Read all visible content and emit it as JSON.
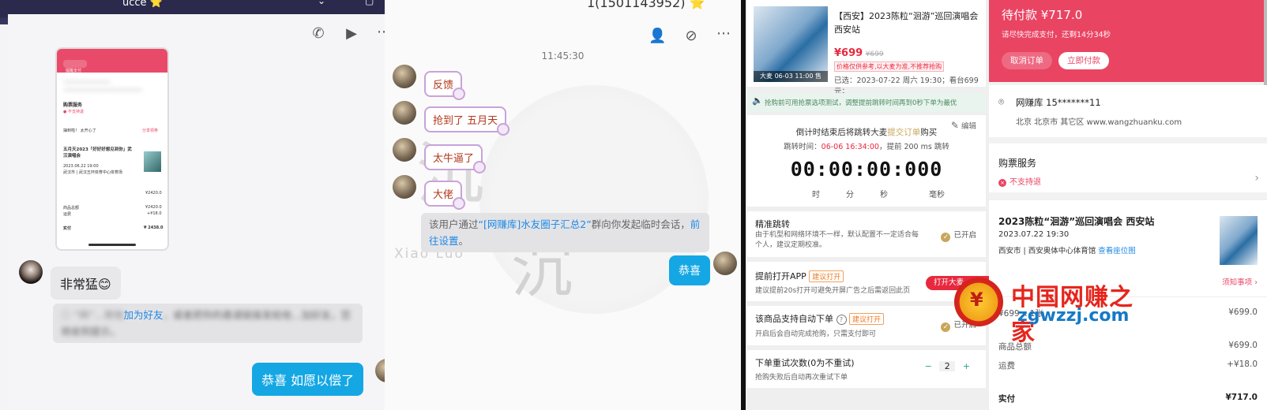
{
  "panel1": {
    "title": "ucce ⭐",
    "mini_phone": {
      "header_btn": "提醒支付",
      "service": "购票服务",
      "not_refund": "● 不支持退",
      "notice": "抽到啦！ 太开心了",
      "notice_tag": "分享领券",
      "event_title": "五月天2023「好好好想见到你」武汉演唱会",
      "event_date": "2023.06.22 19:00",
      "venue": "武汉市 | 武汉五环体育中心体育场",
      "price_row": "¥2420.0",
      "subtotal_label": "商品总额",
      "subtotal": "¥2420.0",
      "fee_label": "运费",
      "fee": "+¥18.0",
      "total_label": "实付",
      "total": "¥ 2438.0"
    },
    "msg_great": "非常猛😊",
    "sys_link1": "加为好友",
    "sys_text": "，或者把你的邀请链接发给他…加好友，您将收到提示。",
    "msg_congrats": "恭喜 如愿以偿了"
  },
  "panel2": {
    "header": "1(1501143952) ⭐",
    "time": "11:45:30",
    "stickers": [
      "反馈",
      "抢到了 五月天",
      "太牛逼了",
      "大佬"
    ],
    "sys_prefix": "该用户通过",
    "sys_group": "“[网赚库]水友圈子汇总2”",
    "sys_middle": "群向你发起临时会话，",
    "sys_link": "前往设置",
    "sys_end": "。",
    "watermark_en": "Xiao Luo",
    "msg_reply": "恭喜"
  },
  "panel3": {
    "event_title": "【西安】2023陈粒“洄游”巡回演唱会 西安站",
    "price": "¥699",
    "price_strike": "¥699",
    "price_note": "价格仅供参考,以大麦为准,不推荐抢购",
    "poster_ribbon": "大麦 06-03 11:00 售",
    "selected": "已选：2023-07-22 周六 19:30；看台699元；",
    "notice": "抢购前可用抢票选项测试，调整提前跳转时间再到0秒下单为最优",
    "countdown_title": "倒计时结束后将跳转大麦",
    "countdown_link": "提交订单",
    "countdown_suffix": "购买",
    "edit": "编辑",
    "jump_time_label": "跳转时间：",
    "jump_time": "06-06 16:34:00",
    "jump_advance": "，提前 200 ms 跳转",
    "timer": "00:00:00:000",
    "units": [
      "时",
      "分",
      "秒",
      "毫秒"
    ],
    "precise_title": "精准跳转",
    "precise_desc": "由于机型和网络环境不一样，默认配置不一定适合每个人，建议定期校准。",
    "precise_status": "已开启",
    "open_app_title": "提前打开APP",
    "open_app_tag": "建议打开",
    "open_app_desc": "建议提前20s打开可避免开屏广告之后需返回此页",
    "open_app_btn": "打开大麦",
    "auto_title": "该商品支持自动下单",
    "auto_tag": "建议打开",
    "auto_desc": "开启后会自动完成抢购，只需支付即可",
    "auto_status": "已开启",
    "retry_title": "下单重试次数(0为不重试)",
    "retry_desc": "抢购失败后自动再次重试下单",
    "retry_value": "2",
    "minus": "−",
    "plus": "+"
  },
  "panel4": {
    "pay_title": "待付款 ¥717.0",
    "pay_desc": "请尽快完成支付，还剩14分34秒",
    "cancel": "取消订单",
    "pay_now": "立即付款",
    "addr_name": "网赚库 15*******11",
    "addr_detail": "北京 北京市 其它区 www.wangzhuanku.com",
    "service": "购票服务",
    "not_refund": "不支持退",
    "event_title": "2023陈粒“洄游”巡回演唱会 西安站",
    "event_date": "2023.07.22 19:30",
    "venue": "西安市 | 西安奥体中心体育馆",
    "venue_link": "查看座位图",
    "notice_link": "须知事项",
    "ticket_price": "¥699.0",
    "item_row_label": "¥699 x 1张",
    "subtotal_label": "商品总额",
    "subtotal": "¥699.0",
    "fee_label": "运费",
    "fee": "+¥18.0",
    "total_label": "实付",
    "total": "¥717.0"
  },
  "watermark": {
    "cn": "中国网赚之家",
    "en": "zgwzzj.com"
  },
  "colors": {
    "accent_red": "#ea4463",
    "chat_blue": "#14a7e4",
    "link_blue": "#1e88e5",
    "gold": "#c8a65a"
  }
}
